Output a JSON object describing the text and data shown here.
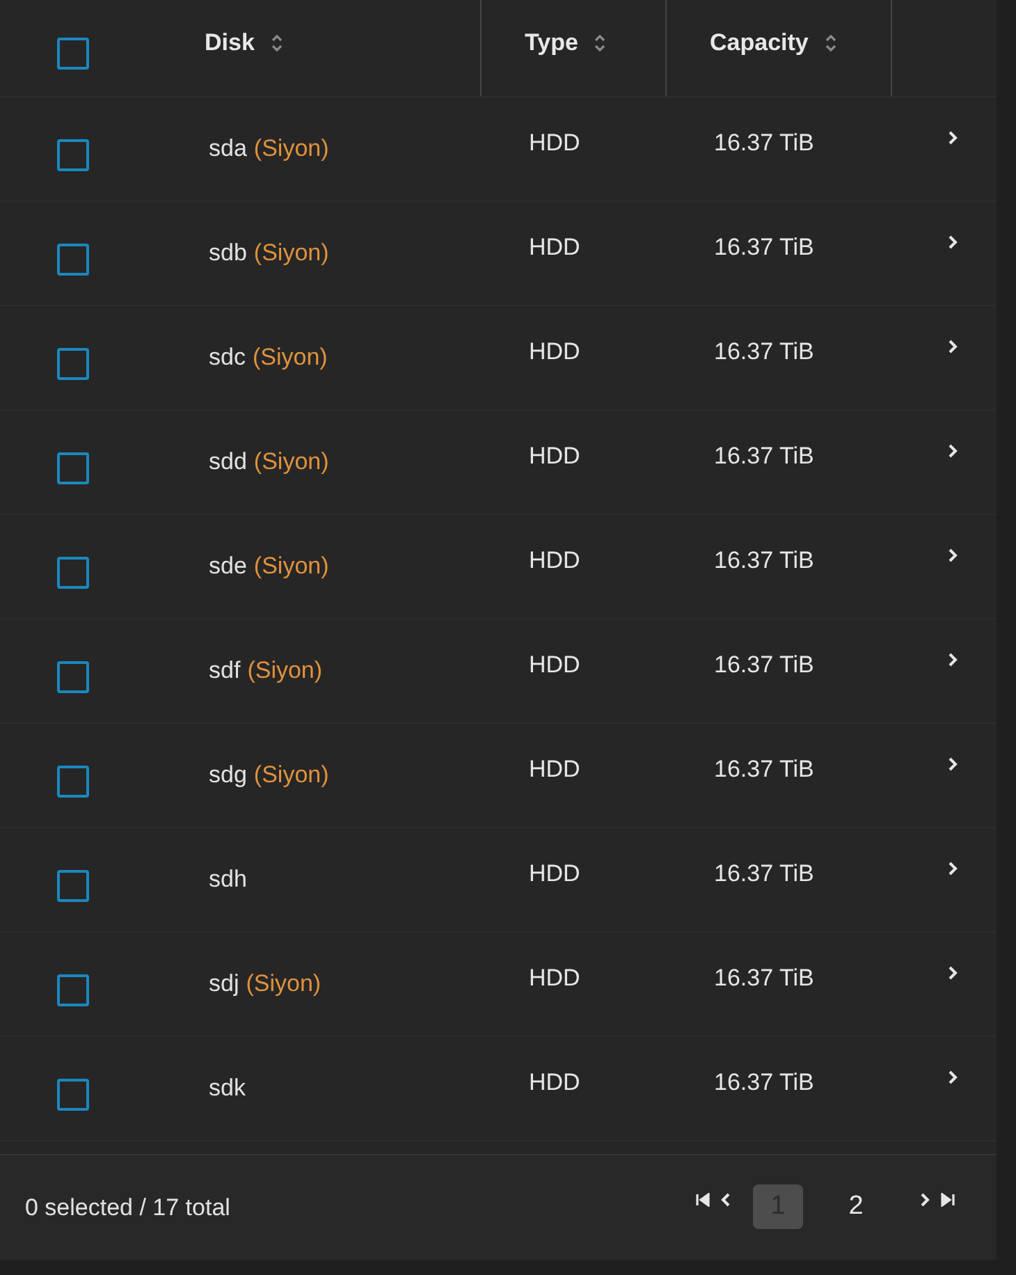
{
  "table": {
    "select_all": {
      "checked": false
    },
    "columns": [
      {
        "label": "Disk"
      },
      {
        "label": "Type"
      },
      {
        "label": "Capacity"
      }
    ],
    "rows": [
      {
        "disk": "sda",
        "pool": "(Siyon)",
        "type": "HDD",
        "capacity": "16.37 TiB",
        "checked": false
      },
      {
        "disk": "sdb",
        "pool": "(Siyon)",
        "type": "HDD",
        "capacity": "16.37 TiB",
        "checked": false
      },
      {
        "disk": "sdc",
        "pool": "(Siyon)",
        "type": "HDD",
        "capacity": "16.37 TiB",
        "checked": false
      },
      {
        "disk": "sdd",
        "pool": "(Siyon)",
        "type": "HDD",
        "capacity": "16.37 TiB",
        "checked": false
      },
      {
        "disk": "sde",
        "pool": "(Siyon)",
        "type": "HDD",
        "capacity": "16.37 TiB",
        "checked": false
      },
      {
        "disk": "sdf",
        "pool": "(Siyon)",
        "type": "HDD",
        "capacity": "16.37 TiB",
        "checked": false
      },
      {
        "disk": "sdg",
        "pool": "(Siyon)",
        "type": "HDD",
        "capacity": "16.37 TiB",
        "checked": false
      },
      {
        "disk": "sdh",
        "type": "HDD",
        "capacity": "16.37 TiB",
        "checked": false
      },
      {
        "disk": "sdj",
        "pool": "(Siyon)",
        "type": "HDD",
        "capacity": "16.37 TiB",
        "checked": false
      },
      {
        "disk": "sdk",
        "type": "HDD",
        "capacity": "16.37 TiB",
        "checked": false
      }
    ]
  },
  "footer": {
    "summary": "0 selected / 17 total",
    "pages": [
      {
        "label": "1",
        "selected": true
      },
      {
        "label": "2",
        "selected": false
      }
    ]
  }
}
